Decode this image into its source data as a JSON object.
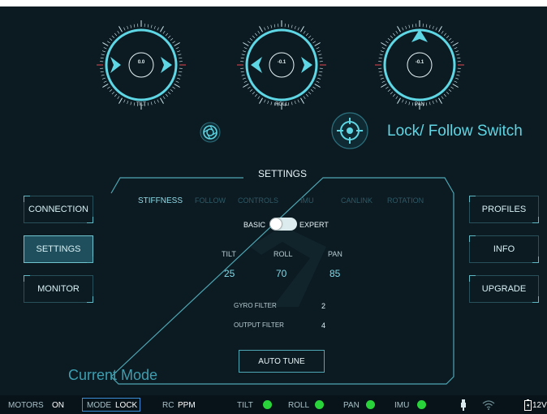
{
  "colors": {
    "background": "#0c1a22",
    "accent": "#5fd6e4",
    "status_on": "#28d43a",
    "tick_red": "#e5484d"
  },
  "dials": [
    {
      "label": "TILT",
      "value": "0.0"
    },
    {
      "label": "ROLL",
      "value": "-0.1"
    },
    {
      "label": "PAN",
      "value": "-0.1"
    }
  ],
  "icons": {
    "camera": "aperture-icon",
    "lock_follow": "crosshair-icon",
    "motor_lock": "lock-icon"
  },
  "lock_follow_switch": {
    "label": "Lock/ Follow Switch"
  },
  "left_menu": [
    {
      "label": "CONNECTION",
      "active": false
    },
    {
      "label": "SETTINGS",
      "active": true
    },
    {
      "label": "MONITOR",
      "active": false
    }
  ],
  "right_menu": [
    {
      "label": "PROFILES"
    },
    {
      "label": "INFO"
    },
    {
      "label": "UPGRADE"
    }
  ],
  "settings": {
    "title": "SETTINGS",
    "tabs": [
      "STIFFNESS",
      "FOLLOW",
      "CONTROLS",
      "IMU",
      "CANLINK",
      "ROTATION"
    ],
    "active_tab": "STIFFNESS",
    "mode_toggle": {
      "left_label": "BASIC",
      "right_label": "EXPERT",
      "state": "basic"
    },
    "axes": [
      {
        "label": "TILT",
        "value": "25"
      },
      {
        "label": "ROLL",
        "value": "70"
      },
      {
        "label": "PAN",
        "value": "85"
      }
    ],
    "filters": [
      {
        "label": "GYRO FILTER",
        "value": "2"
      },
      {
        "label": "OUTPUT FILTER",
        "value": "4"
      }
    ],
    "auto_tune_label": "AUTO TUNE"
  },
  "current_mode_label": "Current Mode",
  "status_bar": {
    "motors_label": "MOTORS",
    "motors_value": "ON",
    "mode_label": "MODE",
    "mode_value": "LOCK",
    "rc_label": "RC",
    "rc_value": "PPM",
    "indicators": [
      "TILT",
      "ROLL",
      "PAN",
      "IMU"
    ],
    "battery": "12V"
  }
}
